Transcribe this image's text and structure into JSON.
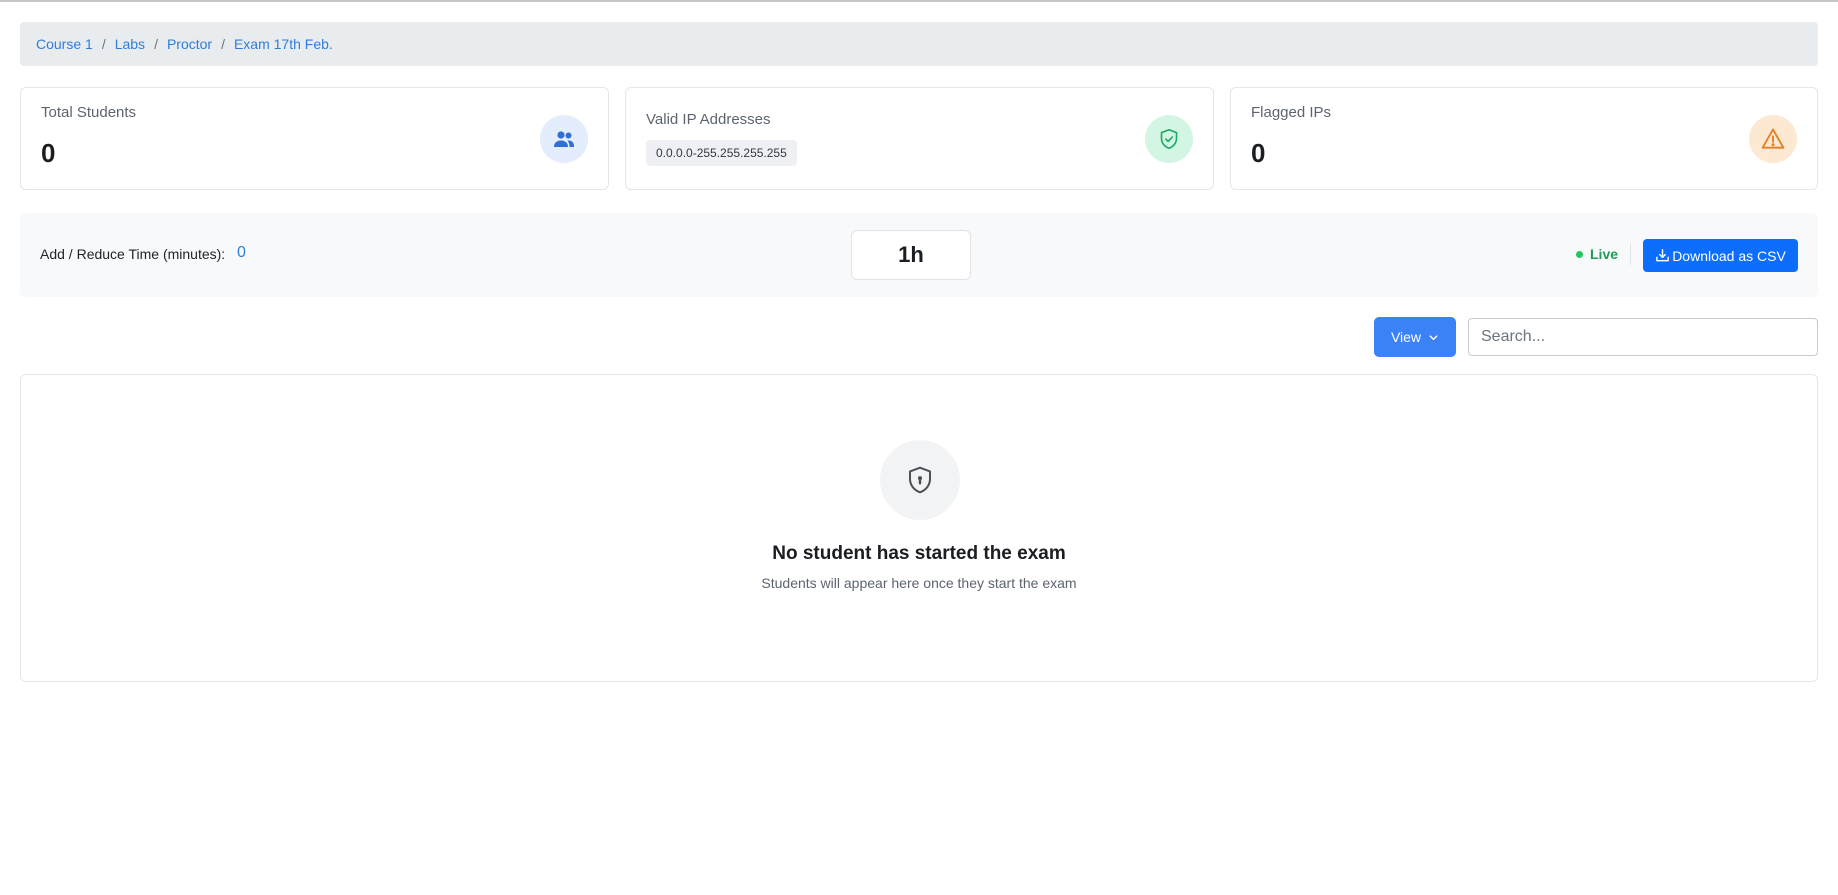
{
  "breadcrumb": [
    "Course 1",
    "Labs",
    "Proctor",
    "Exam 17th Feb."
  ],
  "stats": {
    "total_students": {
      "label": "Total Students",
      "value": "0",
      "icon": "users-icon",
      "accent": "#2f6fd6"
    },
    "valid_ips": {
      "label": "Valid IP Addresses",
      "value": "0.0.0.0-255.255.255.255",
      "icon": "shield-check-icon",
      "accent": "#17a864"
    },
    "flagged_ips": {
      "label": "Flagged IPs",
      "value": "0",
      "icon": "warning-icon",
      "accent": "#e67e22"
    }
  },
  "time_control": {
    "label": "Add / Reduce Time (minutes):",
    "value": "0",
    "timer": "1h",
    "status": "Live",
    "download_label": "Download as CSV"
  },
  "toolbar": {
    "view_label": "View",
    "search_placeholder": "Search..."
  },
  "empty_state": {
    "title": "No student has started the exam",
    "subtitle": "Students will appear here once they start the exam",
    "icon": "shield-lock-icon"
  },
  "colors": {
    "primary": "#0d6efd",
    "link": "#2f7ddb",
    "live": "#1f9d55"
  }
}
